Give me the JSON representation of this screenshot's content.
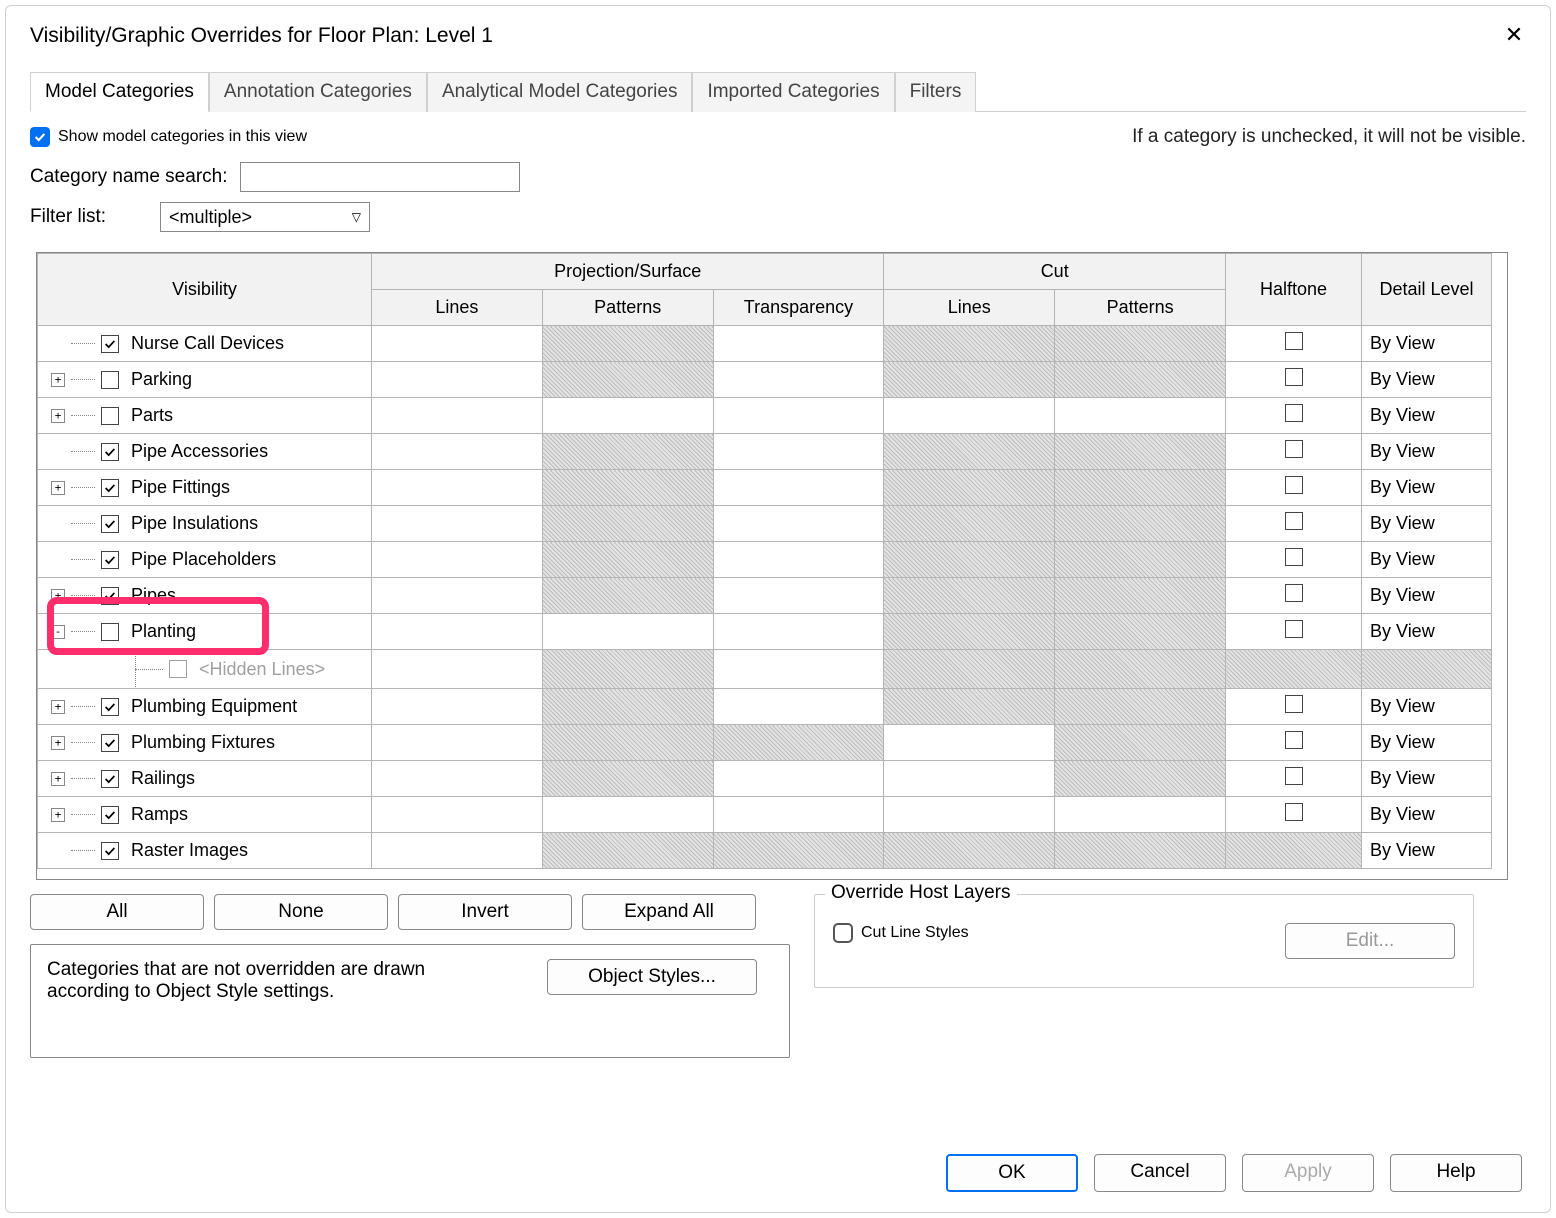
{
  "title": "Visibility/Graphic Overrides for Floor Plan: Level 1",
  "tabs": [
    "Model Categories",
    "Annotation Categories",
    "Analytical Model Categories",
    "Imported Categories",
    "Filters"
  ],
  "active_tab": 0,
  "show_in_view_label": "Show model categories in this view",
  "show_in_view_checked": true,
  "hint": "If a category is unchecked, it will not be visible.",
  "search_label": "Category name search:",
  "search_value": "",
  "filter_label": "Filter list:",
  "filter_value": "<multiple>",
  "headers": {
    "visibility": "Visibility",
    "proj": "Projection/Surface",
    "cut": "Cut",
    "proj_lines": "Lines",
    "proj_patt": "Patterns",
    "proj_trans": "Transparency",
    "cut_lines": "Lines",
    "cut_patt": "Patterns",
    "halftone": "Halftone",
    "detail": "Detail Level"
  },
  "rows": [
    {
      "name": "Nurse Call Devices",
      "checked": true,
      "expander": "",
      "hp": true,
      "hcl": true,
      "hcp": true,
      "half": false,
      "detail": "By View"
    },
    {
      "name": "Parking",
      "checked": false,
      "expander": "+",
      "hp": true,
      "hcl": true,
      "hcp": true,
      "half": false,
      "detail": "By View"
    },
    {
      "name": "Parts",
      "checked": false,
      "expander": "+",
      "half": false,
      "detail": "By View"
    },
    {
      "name": "Pipe Accessories",
      "checked": true,
      "expander": "",
      "hp": true,
      "hcl": true,
      "hcp": true,
      "half": false,
      "detail": "By View"
    },
    {
      "name": "Pipe Fittings",
      "checked": true,
      "expander": "+",
      "hp": true,
      "hcl": true,
      "hcp": true,
      "half": false,
      "detail": "By View"
    },
    {
      "name": "Pipe Insulations",
      "checked": true,
      "expander": "",
      "hp": true,
      "hcl": true,
      "hcp": true,
      "half": false,
      "detail": "By View"
    },
    {
      "name": "Pipe Placeholders",
      "checked": true,
      "expander": "",
      "hp": true,
      "hcl": true,
      "hcp": true,
      "half": false,
      "detail": "By View"
    },
    {
      "name": "Pipes",
      "checked": true,
      "expander": "+",
      "hp": true,
      "hcl": true,
      "hcp": true,
      "half": false,
      "detail": "By View"
    },
    {
      "name": "Planting",
      "checked": false,
      "expander": "-",
      "hcl": true,
      "hcp": true,
      "half": false,
      "detail": "By View",
      "highlight": true
    },
    {
      "name": "<Hidden Lines>",
      "checked": false,
      "expander": "",
      "child": true,
      "gray": true,
      "hp": true,
      "hcl": true,
      "hcp": true,
      "hh": true,
      "hd": true
    },
    {
      "name": "Plumbing Equipment",
      "checked": true,
      "expander": "+",
      "hp": true,
      "hcl": true,
      "hcp": true,
      "half": false,
      "detail": "By View"
    },
    {
      "name": "Plumbing Fixtures",
      "checked": true,
      "expander": "+",
      "hp": true,
      "ht": true,
      "hcp": true,
      "half": false,
      "detail": "By View"
    },
    {
      "name": "Railings",
      "checked": true,
      "expander": "+",
      "hp": true,
      "hcp": true,
      "half": false,
      "detail": "By View"
    },
    {
      "name": "Ramps",
      "checked": true,
      "expander": "+",
      "half": false,
      "detail": "By View"
    },
    {
      "name": "Raster Images",
      "checked": true,
      "expander": "",
      "hp": true,
      "ht": true,
      "hcl": true,
      "hcp": true,
      "hh": true,
      "detail": "By View"
    }
  ],
  "buttons": {
    "all": "All",
    "none": "None",
    "invert": "Invert",
    "expand": "Expand All",
    "styles": "Object Styles...",
    "edit": "Edit..."
  },
  "info_text": "Categories that are not overridden are drawn according to Object Style settings.",
  "group_label": "Override Host Layers",
  "cut_line_styles_label": "Cut Line Styles",
  "footer": {
    "ok": "OK",
    "cancel": "Cancel",
    "apply": "Apply",
    "help": "Help"
  }
}
